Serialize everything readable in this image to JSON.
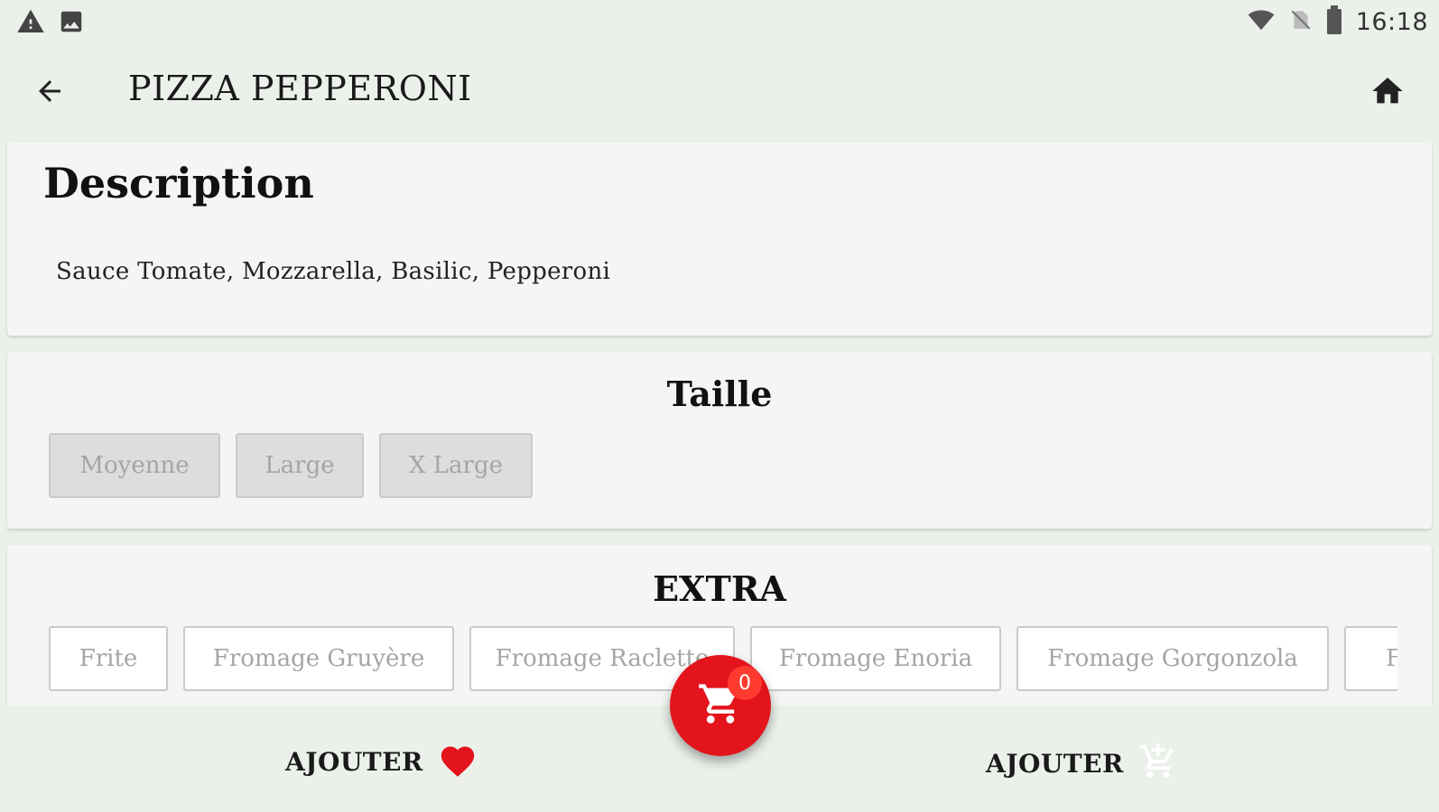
{
  "status_bar": {
    "time": "16:18",
    "left_icons": [
      "warning-icon",
      "image-icon"
    ],
    "right_icons": [
      "wifi-icon",
      "no-sim-icon",
      "battery-icon"
    ]
  },
  "app_bar": {
    "title": "PIZZA PEPPERONI",
    "back_icon": "arrow-left-icon",
    "home_icon": "home-icon"
  },
  "description": {
    "title": "Description",
    "text": "Sauce Tomate, Mozzarella, Basilic, Pepperoni"
  },
  "size": {
    "title": "Taille",
    "options": [
      "Moyenne",
      "Large",
      "X Large"
    ]
  },
  "extra": {
    "title": "EXTRA",
    "options": [
      "Frite",
      "Fromage Gruyère",
      "Fromage Raclette",
      "Fromage Enoria",
      "Fromage Gorgonzola",
      "Fromage"
    ]
  },
  "bottom_bar": {
    "favorite_label": "AJOUTER",
    "cart_label": "AJOUTER",
    "cart_count": "0"
  },
  "colors": {
    "background": "#ebf1ea",
    "card": "#f3f6f2",
    "accent_red": "#e3141c",
    "chip_border": "#c8cbc7",
    "chip_text": "#a3a6a3"
  }
}
